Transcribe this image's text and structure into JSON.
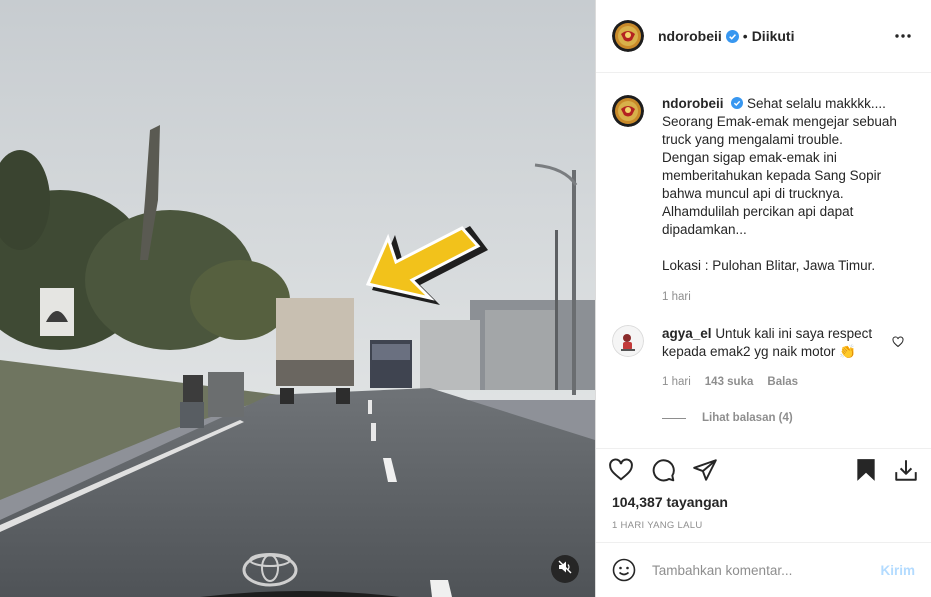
{
  "post": {
    "username": "ndorobeii",
    "separator": "•",
    "follow_state": "Diikuti"
  },
  "caption": {
    "username": "ndorobeii",
    "lines": [
      "Sehat selalu makkkk....",
      "Seorang Emak-emak mengejar sebuah",
      "truck yang mengalami trouble.",
      "Dengan sigap emak-emak ini",
      "memberitahukan kepada Sang Sopir",
      "bahwa muncul api di trucknya.",
      "Alhamdulilah percikan api dapat",
      "dipadamkan..."
    ],
    "location": "Lokasi : Pulohan Blitar, Jawa Timur.",
    "time": "1 hari"
  },
  "comment": {
    "username": "agya_el",
    "text_line1": "Untuk kali ini saya respect",
    "text_line2": "kepada emak2 yg naik motor",
    "emoji": "👏",
    "time": "1 hari",
    "likes": "143 suka",
    "reply": "Balas",
    "view_replies": "Lihat balasan (4)"
  },
  "stats": {
    "views": "104,387 tayangan",
    "posted": "1 HARI YANG LALU"
  },
  "composer": {
    "placeholder": "Tambahkan komentar...",
    "send": "Kirim"
  },
  "icons": {
    "verified": "verified-badge-icon",
    "more": "more-options-icon",
    "like": "heart-icon",
    "comment": "comment-bubble-icon",
    "share": "paper-plane-icon",
    "save": "bookmark-icon",
    "download": "download-icon",
    "emoji": "smiley-icon",
    "mute": "speaker-muted-icon"
  },
  "colors": {
    "verified_blue": "#3897f0",
    "muted_text": "#8e8e8e",
    "send_disabled": "#b3dbff",
    "arrow_yellow": "#f2c21b"
  }
}
